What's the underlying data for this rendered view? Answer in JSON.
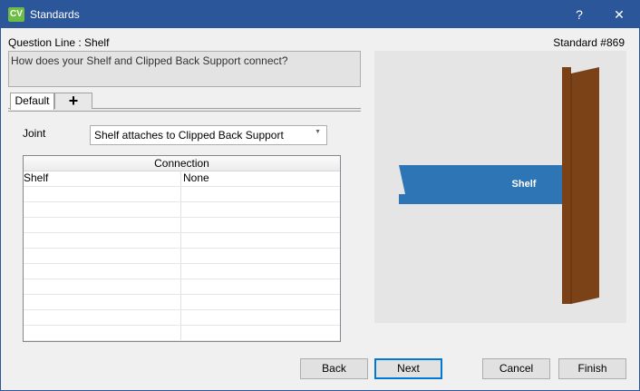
{
  "window": {
    "title": "Standards",
    "app_icon_text": "CV",
    "help_glyph": "?",
    "close_glyph": "✕"
  },
  "header": {
    "question_line_label": "Question Line : Shelf",
    "standard_label": "Standard #869"
  },
  "question": {
    "text": "How does your Shelf and Clipped Back Support connect?"
  },
  "tabs": {
    "items": [
      {
        "label": "Default",
        "active": true
      }
    ],
    "add_glyph": "+"
  },
  "joint": {
    "label": "Joint",
    "selected": "Shelf attaches to Clipped Back Support"
  },
  "grid": {
    "header": "Connection",
    "rows": [
      [
        "Shelf",
        "None"
      ],
      [
        "",
        ""
      ],
      [
        "",
        ""
      ],
      [
        "",
        ""
      ],
      [
        "",
        ""
      ],
      [
        "",
        ""
      ],
      [
        "",
        ""
      ],
      [
        "",
        ""
      ],
      [
        "",
        ""
      ],
      [
        "",
        ""
      ],
      [
        "",
        ""
      ]
    ]
  },
  "preview": {
    "shelf_label": "Shelf",
    "colors": {
      "background": "#e5e5e5",
      "shelf": "#2e75b6",
      "support": "#7b4218",
      "support_edge": "#5a2e0e"
    }
  },
  "buttons": {
    "back": "Back",
    "next": "Next",
    "cancel": "Cancel",
    "finish": "Finish"
  },
  "colors": {
    "titlebar": "#2b579a",
    "app_icon": "#6dbd45",
    "default_button_border": "#0078d7"
  }
}
